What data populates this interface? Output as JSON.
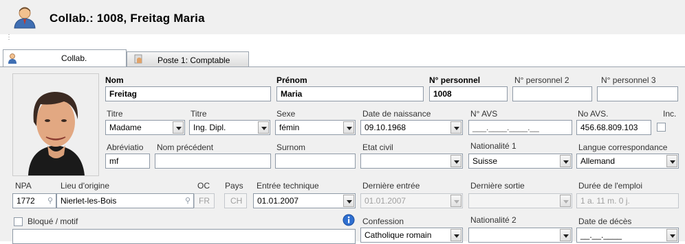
{
  "header": {
    "title": "Collab.: 1008,  Freitag Maria"
  },
  "tabs": [
    {
      "label": "Collab."
    },
    {
      "label": "Poste 1: Comptable"
    }
  ],
  "form": {
    "nom": {
      "label": "Nom",
      "value": "Freitag"
    },
    "prenom": {
      "label": "Prénom",
      "value": "Maria"
    },
    "npers": {
      "label": "N° personnel",
      "value": "1008"
    },
    "npers2": {
      "label": "N° personnel 2",
      "value": ""
    },
    "npers3": {
      "label": "N° personnel 3",
      "value": ""
    },
    "titre1": {
      "label": "Titre",
      "value": "Madame"
    },
    "titre2": {
      "label": "Titre",
      "value": "Ing. Dipl."
    },
    "sexe": {
      "label": "Sexe",
      "value": "fémin"
    },
    "naissance": {
      "label": "Date de naissance",
      "value": "09.10.1968"
    },
    "navs": {
      "label": "N° AVS",
      "value": "___.____.____.__"
    },
    "noavs": {
      "label": "No AVS.",
      "value": "456.68.809.103"
    },
    "inc": {
      "label": "Inc."
    },
    "abrev": {
      "label": "Abréviatio",
      "value": "mf"
    },
    "nomprec": {
      "label": "Nom précédent",
      "value": ""
    },
    "surnom": {
      "label": "Surnom",
      "value": ""
    },
    "etatcivil": {
      "label": "Etat civil",
      "value": ""
    },
    "nat1": {
      "label": "Nationalité 1",
      "value": "Suisse"
    },
    "langue": {
      "label": "Langue correspondance",
      "value": "Allemand"
    },
    "npa": {
      "label": "NPA",
      "value": "1772"
    },
    "lieu": {
      "label": "Lieu d'origine",
      "value": "Nierlet-les-Bois"
    },
    "oc": {
      "label": "OC",
      "value": "FR"
    },
    "pays": {
      "label": "Pays",
      "value": "CH"
    },
    "entree": {
      "label": "Entrée technique",
      "value": "01.01.2007"
    },
    "derentree": {
      "label": "Dernière entrée",
      "value": "01.01.2007"
    },
    "dersortie": {
      "label": "Dernière sortie",
      "value": ""
    },
    "duree": {
      "label": "Durée de l'emploi",
      "value": "1 a.  11 m.  0 j."
    },
    "bloque": {
      "label": "Bloqué / motif"
    },
    "confession": {
      "label": "Confession",
      "value": "Catholique romain"
    },
    "nat2": {
      "label": "Nationalité 2",
      "value": ""
    },
    "deces": {
      "label": "Date de décès",
      "value": "__.__.____"
    }
  },
  "colors": {
    "panel_bg": "#f0f0f0",
    "border": "#8e99a6"
  }
}
